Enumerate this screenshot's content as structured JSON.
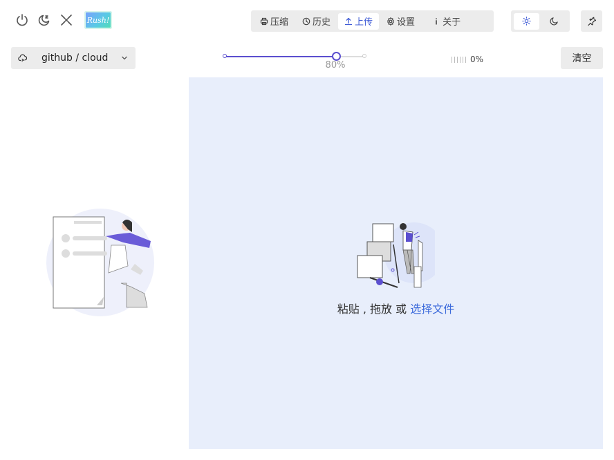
{
  "toolbar": {
    "icons": [
      "power-icon",
      "moon-sleep-icon",
      "shrink-icon"
    ],
    "logo_text": "Rush!"
  },
  "tabs": [
    {
      "label": "压缩",
      "icon": "printer-icon",
      "active": false
    },
    {
      "label": "历史",
      "icon": "history-icon",
      "active": false
    },
    {
      "label": "上传",
      "icon": "upload-icon",
      "active": true
    },
    {
      "label": "设置",
      "icon": "gear-icon",
      "active": false
    },
    {
      "label": "关于",
      "icon": "info-icon",
      "active": false
    }
  ],
  "theme": {
    "options": [
      "light",
      "dark"
    ],
    "selected": "light"
  },
  "colors": {
    "accent": "#5b4fcf",
    "link": "#3d6bdb",
    "dropzone_bg": "#e8eefb",
    "tab_active": "#3f5bd6"
  },
  "repo_select": {
    "value": "github / cloud"
  },
  "quality_slider": {
    "value": 80,
    "display": "80%"
  },
  "progress": {
    "display": "0%"
  },
  "clear_label": "清空",
  "dropzone": {
    "text_prefix": "粘贴 , 拖放 或 ",
    "link_text": "选择文件"
  }
}
